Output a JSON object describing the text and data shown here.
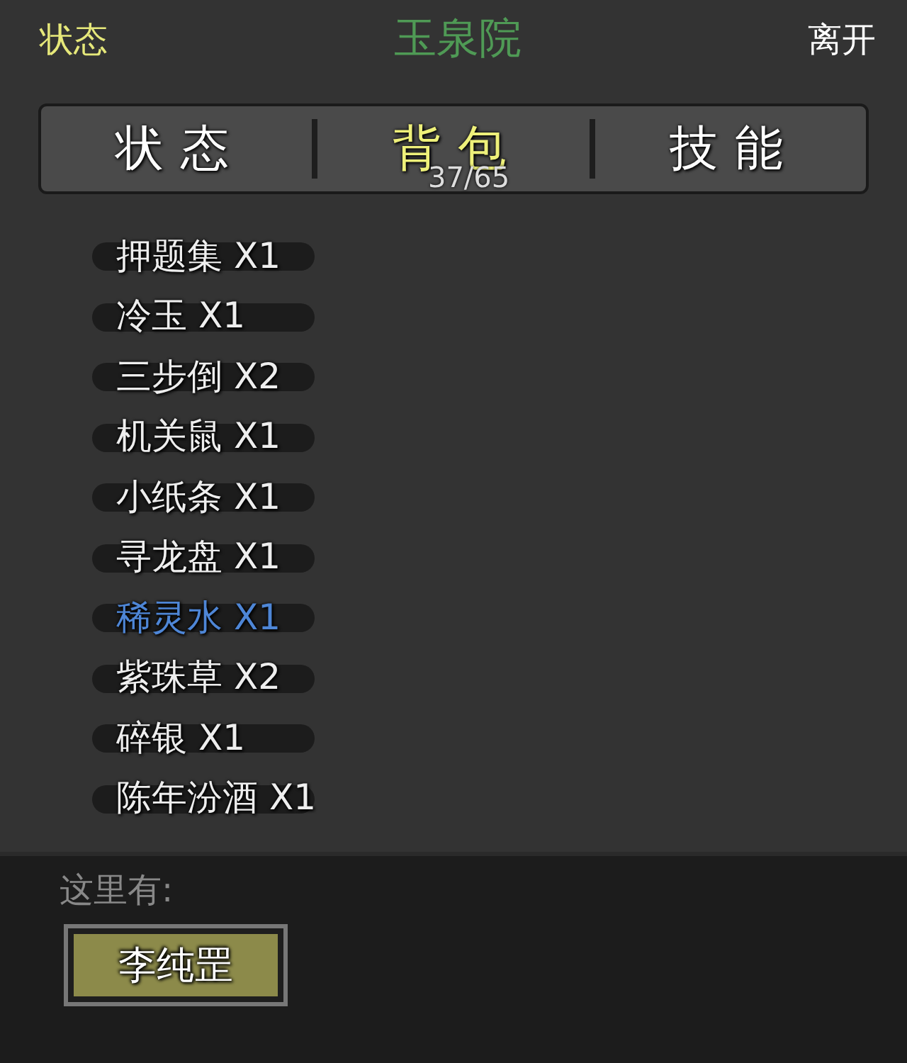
{
  "header": {
    "left": "状态",
    "title": "玉泉院",
    "right": "离开"
  },
  "tabs": [
    {
      "label": "状态",
      "selected": false
    },
    {
      "label": "背包",
      "selected": true,
      "count": "37/65"
    },
    {
      "label": "技能",
      "selected": false
    }
  ],
  "items": [
    {
      "label": "押题集 X1",
      "selected": false
    },
    {
      "label": "冷玉 X1",
      "selected": false
    },
    {
      "label": "三步倒 X2",
      "selected": false
    },
    {
      "label": "机关鼠 X1",
      "selected": false
    },
    {
      "label": "小纸条 X1",
      "selected": false
    },
    {
      "label": "寻龙盘 X1",
      "selected": false
    },
    {
      "label": "稀灵水 X1",
      "selected": true
    },
    {
      "label": "紫珠草 X2",
      "selected": false
    },
    {
      "label": "碎银 X1",
      "selected": false
    },
    {
      "label": "陈年汾酒 X1",
      "selected": false
    }
  ],
  "here": {
    "label": "这里有:",
    "npcs": [
      "李纯罡"
    ]
  }
}
